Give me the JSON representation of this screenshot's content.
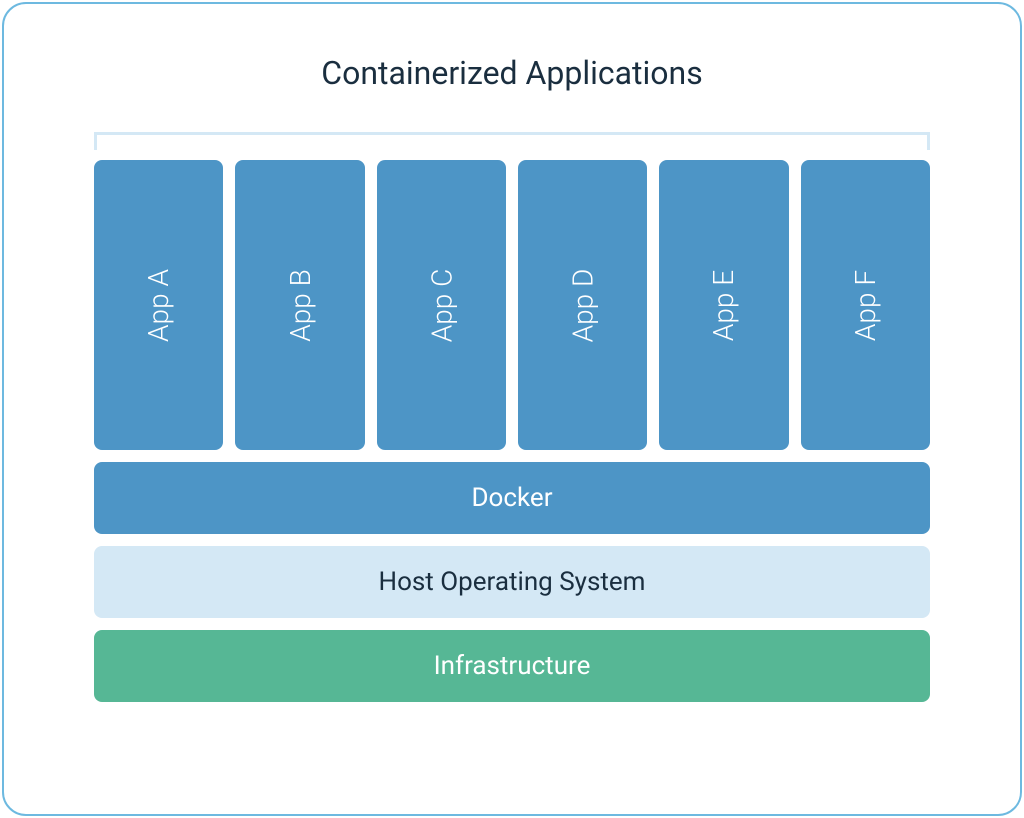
{
  "title": "Containerized Applications",
  "apps": [
    {
      "label": "App A"
    },
    {
      "label": "App B"
    },
    {
      "label": "App C"
    },
    {
      "label": "App D"
    },
    {
      "label": "App E"
    },
    {
      "label": "App F"
    }
  ],
  "layers": {
    "docker": "Docker",
    "host": "Host Operating System",
    "infrastructure": "Infrastructure"
  },
  "colors": {
    "border": "#6db9e0",
    "app_bg": "#4d95c6",
    "docker_bg": "#4d95c6",
    "host_bg": "#d4e8f5",
    "infra_bg": "#56b795",
    "title_text": "#1a2e3f"
  }
}
